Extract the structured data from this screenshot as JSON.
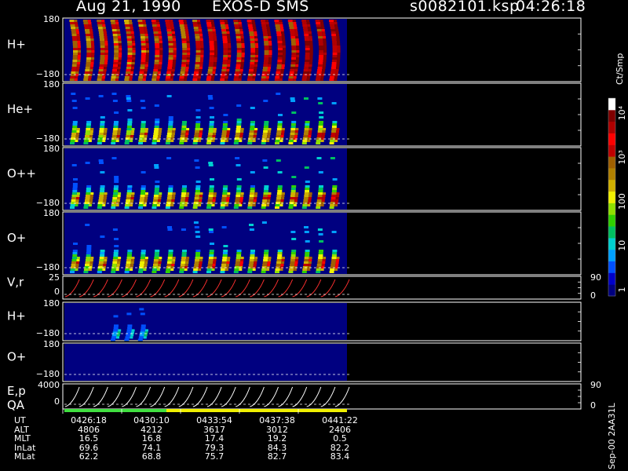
{
  "header": {
    "date": "Aug 21, 1990",
    "instrument": "EXOS-D SMS",
    "file": "s0082101.ksp",
    "time": "04:26:18"
  },
  "colorbar": {
    "unit": "Ct/Smp",
    "ticks": [
      {
        "value": 1,
        "label": "1"
      },
      {
        "value": 10,
        "label": "10"
      },
      {
        "value": 100,
        "label": "100"
      },
      {
        "value": 1000,
        "label": "10³"
      },
      {
        "value": 10000,
        "label": "10⁴"
      }
    ],
    "colors": [
      "#000080",
      "#0000c8",
      "#0050ff",
      "#00a0ff",
      "#00d0d0",
      "#00c060",
      "#30d000",
      "#90e000",
      "#f0f000",
      "#d0b000",
      "#b08000",
      "#a06000",
      "#c00000",
      "#ff0000",
      "#b00000",
      "#800000",
      "#ffffff"
    ]
  },
  "right_label": "Sep-00 2AA31L",
  "chart_data": [
    {
      "type": "heatmap",
      "label": "H+",
      "ylim": [
        -180,
        180
      ],
      "ticks": [
        "180",
        "−180"
      ],
      "pattern": "strong"
    },
    {
      "type": "heatmap",
      "label": "He+",
      "ylim": [
        -180,
        180
      ],
      "ticks": [
        "180",
        "−180"
      ],
      "pattern": "medium"
    },
    {
      "type": "heatmap",
      "label": "O++",
      "ylim": [
        -180,
        180
      ],
      "ticks": [
        "180",
        "−180"
      ],
      "pattern": "medium"
    },
    {
      "type": "heatmap",
      "label": "O+",
      "ylim": [
        -180,
        180
      ],
      "ticks": [
        "180",
        "−180"
      ],
      "pattern": "medium"
    },
    {
      "type": "line",
      "label": "V,r",
      "ylim": [
        0,
        25
      ],
      "ticks": [
        "25",
        "0"
      ],
      "right_ticks": [
        "90",
        "0"
      ],
      "color": "#ff3030"
    },
    {
      "type": "heatmap",
      "label": "H+",
      "ylim": [
        -180,
        180
      ],
      "ticks": [
        "180",
        "−180"
      ],
      "pattern": "sparse"
    },
    {
      "type": "heatmap",
      "label": "O+",
      "ylim": [
        -180,
        180
      ],
      "ticks": [
        "180",
        "−180"
      ],
      "pattern": "empty"
    },
    {
      "type": "line",
      "label": "E,p",
      "label2": "QA",
      "ylim": [
        0,
        4000
      ],
      "ticks": [
        "4000",
        "0"
      ],
      "right_ticks": [
        "90",
        "0"
      ],
      "color": "#ffffff"
    }
  ],
  "footer": {
    "rows": [
      {
        "label": "UT",
        "values": [
          "0426:18",
          "0430:10",
          "0433:54",
          "0437:38",
          "0441:22"
        ]
      },
      {
        "label": "ALT",
        "values": [
          "4806",
          "4212",
          "3617",
          "3012",
          "2406"
        ]
      },
      {
        "label": "MLT",
        "values": [
          "16.5",
          "16.8",
          "17.4",
          "19.2",
          "0.5"
        ]
      },
      {
        "label": "InLat",
        "values": [
          "69.6",
          "74.1",
          "79.3",
          "84.3",
          "82.2"
        ]
      },
      {
        "label": "MLat",
        "values": [
          "62.2",
          "68.8",
          "75.7",
          "82.7",
          "83.4"
        ]
      }
    ]
  }
}
